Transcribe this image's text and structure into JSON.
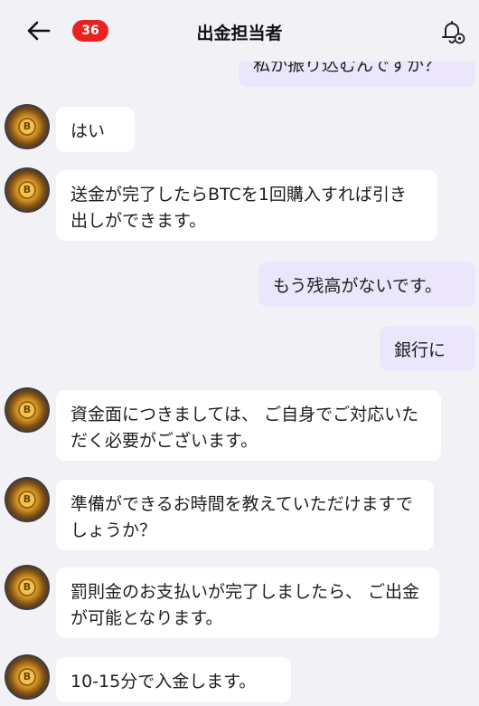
{
  "header": {
    "back_icon": "arrow-left-icon",
    "unread_count": "36",
    "title": "出金担当者",
    "bell_icon": "bell-settings-icon",
    "badge_color": "#e8231f"
  },
  "messages": [
    {
      "side": "out",
      "text": "私か振り込むんですか？"
    },
    {
      "side": "in",
      "text": "はい"
    },
    {
      "side": "in",
      "text": "送金が完了したらBTCを1回購入すれば引き出しができます。"
    },
    {
      "side": "out",
      "text": "もう残高がないです。"
    },
    {
      "side": "out",
      "text": "銀行に"
    },
    {
      "side": "in",
      "text": "資金面につきましては、 ご自身でご対応いただく必要がございます。"
    },
    {
      "side": "in",
      "text": "準備ができるお時間を教えていただけますでしょうか？"
    },
    {
      "side": "in",
      "text": "罰則金のお支払いが完了しましたら、 ご出金が可能となります。"
    },
    {
      "side": "in",
      "text": "10-15分で入金します。"
    }
  ],
  "avatar_icon": "bitcoin-avatar-icon",
  "colors": {
    "incoming_bubble": "#ffffff",
    "outgoing_bubble": "#ebe6fb",
    "background": "#f2f1f6"
  }
}
